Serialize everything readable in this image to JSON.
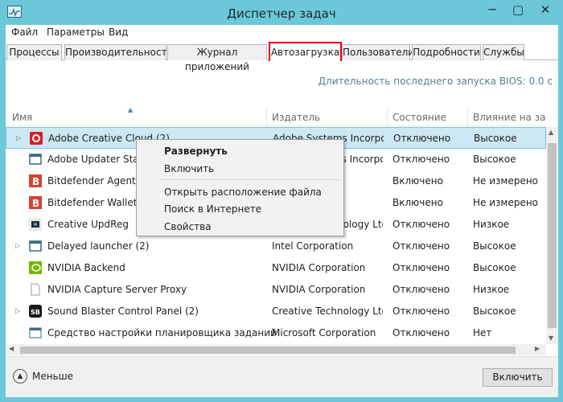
{
  "window": {
    "title": "Диспетчер задач",
    "min": "─",
    "max": "▢",
    "close": "✕"
  },
  "menubar": [
    "Файл",
    "Параметры",
    "Вид"
  ],
  "tabs": [
    {
      "label": "Процессы",
      "active": false
    },
    {
      "label": "Производительность",
      "active": false
    },
    {
      "label": "Журнал приложений",
      "active": false
    },
    {
      "label": "Автозагрузка",
      "active": true
    },
    {
      "label": "Пользователи",
      "active": false
    },
    {
      "label": "Подробности",
      "active": false
    },
    {
      "label": "Службы",
      "active": false
    }
  ],
  "bios": "Длительность последнего запуска BIOS: 0.0 с",
  "columns": {
    "name": "Имя",
    "publisher": "Издатель",
    "status": "Состояние",
    "impact": "Влияние на за..."
  },
  "rows": [
    {
      "expand": true,
      "icon": "adobe-cc-icon",
      "icon_color": "#d71f26",
      "name": "Adobe Creative Cloud (2)",
      "publisher": "Adobe Systems Incorporated",
      "status": "Отключено",
      "impact": "Высокое",
      "selected": true
    },
    {
      "expand": false,
      "icon": "generic-app-icon",
      "icon_color": "#3c6a82",
      "name": "Adobe Updater Startup Utility",
      "publisher": "Adobe Systems Incorporated",
      "status": "Отключено",
      "impact": "Высокое",
      "selected": false
    },
    {
      "expand": false,
      "icon": "bitdefender-icon",
      "icon_color": "#d8412f",
      "name": "Bitdefender Agent",
      "publisher": "",
      "status": "Включено",
      "impact": "Не измерено",
      "selected": false
    },
    {
      "expand": false,
      "icon": "bitdefender-icon",
      "icon_color": "#d8412f",
      "name": "Bitdefender Wallet Agent",
      "publisher": "",
      "status": "Включено",
      "impact": "Не измерено",
      "selected": false
    },
    {
      "expand": false,
      "icon": "creative-updreg-icon",
      "icon_color": "#2a2a2a",
      "name": "Creative UpdReg",
      "publisher": "Creative Technology Ltd.",
      "status": "Отключено",
      "impact": "Низкое",
      "selected": false
    },
    {
      "expand": true,
      "icon": "generic-app-icon",
      "icon_color": "#3c6a82",
      "name": "Delayed launcher (2)",
      "publisher": "Intel Corporation",
      "status": "Отключено",
      "impact": "Высокое",
      "selected": false
    },
    {
      "expand": false,
      "icon": "nvidia-icon",
      "icon_color": "#76b900",
      "name": "NVIDIA Backend",
      "publisher": "NVIDIA Corporation",
      "status": "Отключено",
      "impact": "Высокое",
      "selected": false
    },
    {
      "expand": false,
      "icon": "document-icon",
      "icon_color": "#ffffff",
      "name": "NVIDIA Capture Server Proxy",
      "publisher": "NVIDIA Corporation",
      "status": "Отключено",
      "impact": "Низкое",
      "selected": false
    },
    {
      "expand": true,
      "icon": "sound-blaster-icon",
      "icon_color": "#1a1a1a",
      "name": "Sound Blaster Control Panel (2)",
      "publisher": "Creative Technology Ltd",
      "status": "Отключено",
      "impact": "Высокое",
      "selected": false
    },
    {
      "expand": false,
      "icon": "scheduler-icon",
      "icon_color": "#3c6a82",
      "name": "Средство настройки планировщика заданий",
      "publisher": "Microsoft Corporation",
      "status": "Отключено",
      "impact": "Нет",
      "selected": false
    }
  ],
  "context_menu": {
    "items": [
      {
        "label": "Развернуть",
        "bold": true
      },
      {
        "label": "Включить",
        "bold": false
      },
      {
        "label": "Открыть расположение файла",
        "bold": false
      },
      {
        "label": "Поиск в Интернете",
        "bold": false
      },
      {
        "label": "Свойства",
        "bold": false
      }
    ]
  },
  "footer": {
    "less_label": "Меньше",
    "enable_button": "Включить"
  },
  "colors": {
    "accent": "#6cc8d8",
    "selected_row": "#cce8f4",
    "active_tab_border": "#e60012"
  }
}
